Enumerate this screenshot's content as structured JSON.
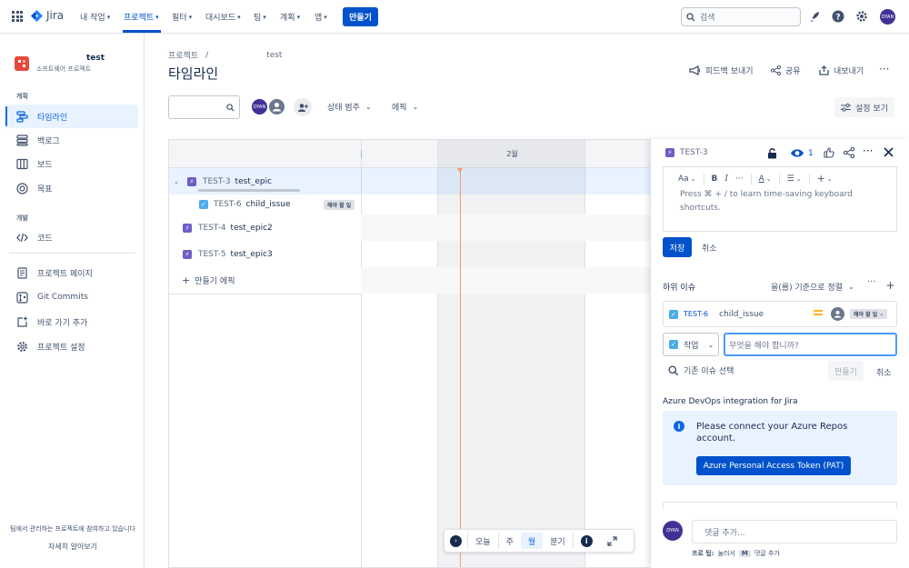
{
  "nav": {
    "product": "Jira",
    "items": [
      {
        "label": "내 작업"
      },
      {
        "label": "프로젝트"
      },
      {
        "label": "필터"
      },
      {
        "label": "대시보드"
      },
      {
        "label": "팀"
      },
      {
        "label": "계획"
      },
      {
        "label": "앱"
      }
    ],
    "create": "만들기",
    "search_placeholder": "검색",
    "avatar": "DYAN"
  },
  "sidebar": {
    "project_name": "test",
    "project_type": "소프트웨어 프로젝트",
    "section_plan": "계획",
    "section_dev": "개발",
    "items": {
      "timeline": "타임라인",
      "backlog": "백로그",
      "board": "보드",
      "goals": "목표",
      "code": "코드",
      "project_pages": "프로젝트 페이지",
      "git_commits": "Git Commits",
      "add_shortcut": "바로 가기 추가",
      "project_settings": "프로젝트 설정"
    },
    "footer_text": "팀에서 관리하는 프로젝트에 참여하고 있습니다",
    "footer_link": "자세히 알아보기"
  },
  "main": {
    "breadcrumb_root": "프로젝트",
    "breadcrumb_sep": "/",
    "breadcrumb_project": "test",
    "title": "타임라인",
    "actions": {
      "feedback": "피드백 보내기",
      "share": "공유",
      "export": "내보내기"
    },
    "filters": {
      "avatar": "DYAN",
      "status_category": "상태 범주",
      "epic": "에픽"
    },
    "settings": "설정 보기"
  },
  "timeline": {
    "month": "2월",
    "rows": [
      {
        "key": "TEST-3",
        "summary": "test_epic",
        "type": "epic"
      },
      {
        "key": "TEST-6",
        "summary": "child_issue",
        "type": "task",
        "status": "해야 할 일"
      },
      {
        "key": "TEST-4",
        "summary": "test_epic2",
        "type": "epic"
      },
      {
        "key": "TEST-5",
        "summary": "test_epic3",
        "type": "epic"
      }
    ],
    "create_epic": "만들기 에픽",
    "bottom": {
      "today": "오늘",
      "week": "주",
      "month": "월",
      "quarter": "분기"
    }
  },
  "panel": {
    "issue_key": "TEST-3",
    "watchers": "1",
    "editor_toolbar": {
      "text_style": "Aa",
      "bold": "B",
      "italic": "I",
      "more": "···",
      "color": "A",
      "list": "☰",
      "insert": "+"
    },
    "editor_hint_line1": "Press ⌘ + / to learn time-saving keyboard",
    "editor_hint_line2": "shortcuts.",
    "save": "저장",
    "cancel": "취소",
    "child_issues_label": "하위 이슈",
    "sort_label": "을(를) 기준으로 정렬",
    "child": {
      "key": "TEST-6",
      "summary": "child_issue",
      "status": "해야 할 일"
    },
    "new_child_type": "작업",
    "new_child_placeholder": "무엇을 해야 합니까?",
    "choose_existing": "기존 이슈 선택",
    "create": "만들기",
    "cancel2": "취소",
    "azure_heading": "Azure DevOps integration for Jira",
    "azure_message": "Please connect your Azure Repos account.",
    "azure_button": "Azure Personal Access Token (PAT)",
    "comment_avatar": "DYAN",
    "comment_placeholder": "댓글 추가...",
    "tip_prefix": "프로 팁:",
    "tip_text": "눌러서",
    "tip_key": "M",
    "tip_suffix": "댓글 추가"
  }
}
